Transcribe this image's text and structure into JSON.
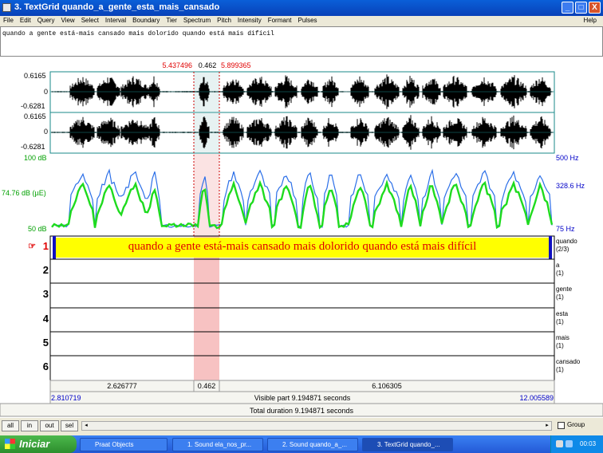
{
  "window": {
    "title": "3. TextGrid quando_a_gente_esta_mais_cansado",
    "controls": {
      "minimize": "_",
      "maximize": "□",
      "close": "X"
    }
  },
  "menu": {
    "items": [
      "File",
      "Edit",
      "Query",
      "View",
      "Select",
      "Interval",
      "Boundary",
      "Tier",
      "Spectrum",
      "Pitch",
      "Intensity",
      "Formant",
      "Pulses"
    ],
    "help": "Help"
  },
  "text_box": {
    "value": "quando a gente está-mais cansado mais dolorido quando está mais difícil"
  },
  "selection": {
    "start": "5.437496",
    "length": "0.462",
    "end": "5.899365"
  },
  "waveform": {
    "ch1": {
      "max": "0.6165",
      "zero": "0",
      "min": "-0.6281"
    },
    "ch2": {
      "max": "0.6165",
      "zero": "0",
      "min": "-0.6281"
    }
  },
  "analysis": {
    "intensity_top": "100 dB",
    "intensity_mid": "74.76 dB (µE)",
    "intensity_bottom": "50 dB",
    "pitch_top": "500 Hz",
    "pitch_mid": "328.6 Hz",
    "pitch_bottom": "75 Hz"
  },
  "tiers": [
    {
      "num": "1",
      "pointer": "☞",
      "text": "quando a gente está-mais cansado mais dolorido quando está mais difícil",
      "name": "quando",
      "count": "(2/3)"
    },
    {
      "num": "2",
      "name": "a",
      "count": "(1)"
    },
    {
      "num": "3",
      "name": "gente",
      "count": "(1)"
    },
    {
      "num": "4",
      "name": "esta",
      "count": "(1)"
    },
    {
      "num": "5",
      "name": "mais",
      "count": "(1)"
    },
    {
      "num": "6",
      "name": "cansado",
      "count": "(1)"
    }
  ],
  "time_bar": {
    "before": "2.626777",
    "sel": "0.462",
    "after": "6.106305",
    "visible_start": "2.810719",
    "visible_label": "Visible part 9.194871 seconds",
    "visible_end": "12.005589",
    "total_label": "Total duration 9.194871 seconds"
  },
  "buttons": {
    "all": "all",
    "in": "in",
    "out": "out",
    "sel": "sel",
    "group": "Group"
  },
  "taskbar": {
    "start": "Iniciar",
    "items": [
      "Praat Objects",
      "1. Sound ela_nos_pr...",
      "2. Sound quando_a_...",
      "3. TextGrid quando_..."
    ],
    "clock": "00:03"
  },
  "colors": {
    "selection": "#f7c2c2",
    "pitch": "#2b6fe8",
    "intensity": "#1edb1e",
    "tier_highlight": "#ffff00",
    "border_teal": "#1a8a8a"
  },
  "icons": [
    "praat-icon",
    "windows-flag-icon",
    "speaker-icon",
    "network-icon"
  ]
}
